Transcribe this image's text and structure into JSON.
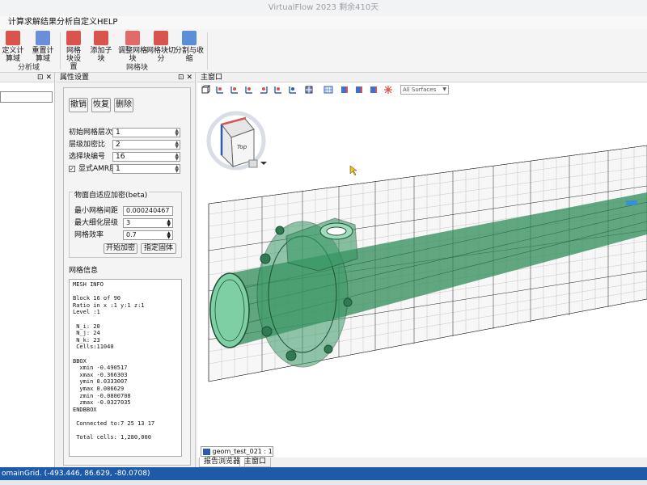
{
  "window": {
    "title": "VirtualFlow 2023 剩余410天"
  },
  "menu": [
    "计算求解",
    "结果分析",
    "自定义",
    "HELP"
  ],
  "ribbon": {
    "left_buttons": [
      "定义计算域",
      "重置计算域"
    ],
    "left_group": "分析域",
    "buttons": [
      "网格块设置",
      "添加子块",
      "调整网格块",
      "网格块切分",
      "分割与收缩"
    ],
    "mid_group": "网格块"
  },
  "left_panel": {
    "controls": "⊡ ✕"
  },
  "props": {
    "title": "属性设置",
    "controls": "⊡ ✕",
    "btn_undo": "撤销",
    "btn_restore": "恢复",
    "btn_delete": "删除",
    "label_init_level": "初始网格层次数",
    "value_init_level": "1",
    "label_ratio": "层级加密比",
    "value_ratio": "2",
    "label_block": "选择块编号",
    "value_block": "16",
    "label_amr": "显式AMR层级",
    "value_amr": "1",
    "amr_checked": "✓",
    "group_title": "物面自适应加密(beta)",
    "label_min_spacing": "最小网格间距",
    "value_min_spacing": "0.000240467",
    "label_max_level": "最大细化层级",
    "value_max_level": "3",
    "label_efficiency": "网格效率",
    "value_efficiency": "0.7",
    "btn_start_refine": "开始加密",
    "btn_assign_solid": "指定固体",
    "mesh_info_label": "网格信息",
    "mesh_info": "MESH INFO\n\nBlock 16 of 90\nRatio in x :1 y:1 z:1\nLevel :1\n\n N_i: 20\n N_j: 24\n N_k: 23\n Cells:11040\n\nBBOX\n  xmin -0.490517\n  xmax -0.366303\n  ymin 0.0333007\n  ymax 0.086629\n  zmin -0.0800708\n  zmax -0.0327035\nENDBBOX\n\n Connected to:7 25 13 17\n\n Total cells: 1,280,000"
  },
  "main": {
    "title": "主窗口",
    "surface_dropdown": "All Surfaces",
    "cube_face": "Top",
    "doc_tab": "geom_test_021 : 1",
    "bottom_tabs": [
      "报告浏览器",
      "主窗口"
    ]
  },
  "status": {
    "text": "omainGrid. (-493.446, 86.629, -80.0708)"
  },
  "colors": {
    "accent": "#1e5aa8",
    "mesh_green": "#2e8b57"
  }
}
